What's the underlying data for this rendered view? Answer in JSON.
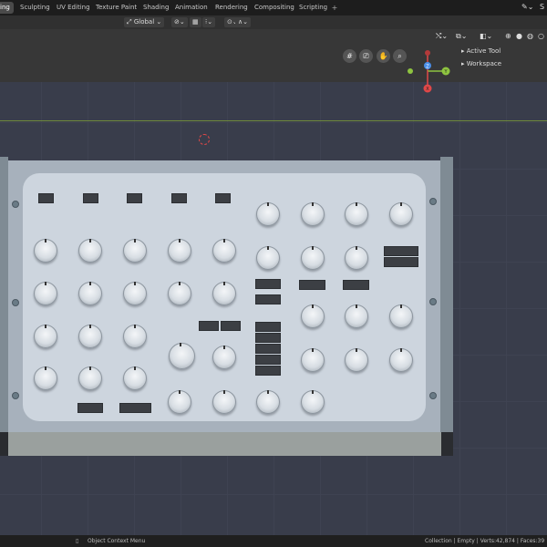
{
  "workspace_tabs": [
    "ing",
    "Sculpting",
    "UV Editing",
    "Texture Paint",
    "Shading",
    "Animation",
    "Rendering",
    "Compositing",
    "Scripting"
  ],
  "active_tab_index": 0,
  "more_tabs_label": "+",
  "header": {
    "transform_orientation": "Global",
    "top_right_user": "S"
  },
  "sidebar_panel": {
    "items": [
      "Active Tool",
      "Workspace"
    ]
  },
  "gizmo": {
    "x_label": "X",
    "y_label": "Y",
    "z_label": "Z"
  },
  "statusbar": {
    "left_hint": "Object Context Menu",
    "right_info": "Collection | Empty | Verts:42,874 | Faces:39"
  },
  "colors": {
    "x_axis": "#e04848",
    "y_axis": "#8ec440",
    "z_axis": "#4a8ee8",
    "panel_face": "#cdd5de"
  }
}
